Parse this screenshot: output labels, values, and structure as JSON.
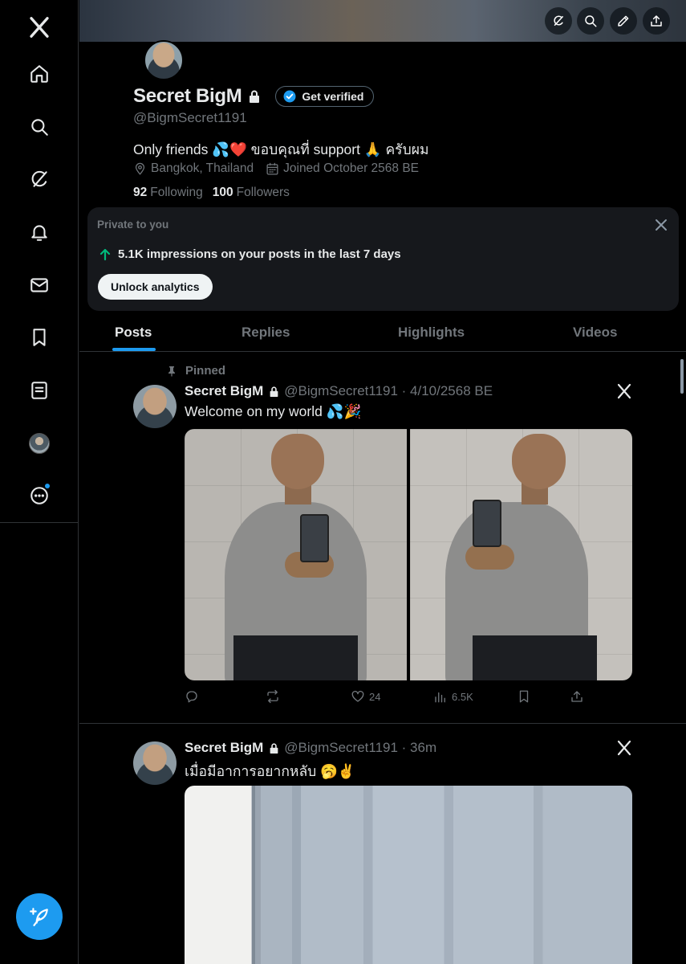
{
  "rail": {
    "items": [
      {
        "name": "x-logo-icon"
      },
      {
        "name": "home-icon"
      },
      {
        "name": "search-icon"
      },
      {
        "name": "grok-icon"
      },
      {
        "name": "bell-icon"
      },
      {
        "name": "mail-icon"
      },
      {
        "name": "bookmark-icon"
      },
      {
        "name": "lists-icon"
      },
      {
        "name": "avatar"
      },
      {
        "name": "more-icon"
      }
    ],
    "compose_icon": "feather-plus-icon"
  },
  "profile": {
    "display_name": "Secret BigM",
    "verify_label": "Get verified",
    "handle": "@BigmSecret1191",
    "bio": "Only friends 💦❤️ ขอบคุณที่ support 🙏 ครับผม",
    "location": "Bangkok, Thailand",
    "joined": "Joined October 2568 BE",
    "following_count": "92",
    "following_label": "Following",
    "followers_count": "100",
    "followers_label": "Followers"
  },
  "analytics": {
    "label": "Private to you",
    "stat": "5.1K impressions on your posts in the last 7 days",
    "button": "Unlock analytics"
  },
  "tabs": [
    {
      "label": "Posts",
      "active": true
    },
    {
      "label": "Replies",
      "active": false
    },
    {
      "label": "Highlights",
      "active": false
    },
    {
      "label": "Videos",
      "active": false
    }
  ],
  "posts": [
    {
      "pinned_label": "Pinned",
      "name": "Secret BigM",
      "meta": "@BigmSecret1191 · 4/10/2568 BE",
      "text": "Welcome on my world 💦🎉",
      "likes": "24",
      "views": "6.5K"
    },
    {
      "name": "Secret BigM",
      "meta": "@BigmSecret1191 · 36m",
      "text": "เมื่อมีอาการอยากหลับ 🥱✌️"
    }
  ],
  "colors": {
    "accent": "#1d9bf0",
    "background": "#000000",
    "muted": "#71767b",
    "up_arrow": "#00ba7c"
  }
}
